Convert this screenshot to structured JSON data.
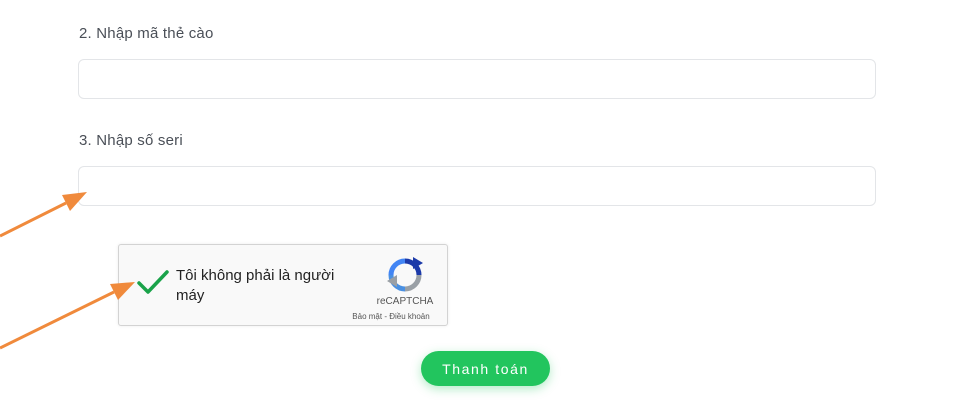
{
  "form": {
    "card_code_label": "2. Nhập mã thẻ cào",
    "card_code_value": "",
    "serial_label": "3. Nhập số seri",
    "serial_value": ""
  },
  "captcha": {
    "checked": true,
    "text": "Tôi không phải là người máy",
    "brand": "reCAPTCHA",
    "privacy_link": "Bảo mật",
    "separator": " - ",
    "terms_link": "Điều khoản"
  },
  "actions": {
    "pay_label": "Thanh toán"
  },
  "colors": {
    "pay_button": "#22c55e",
    "check_mark": "#1aa34a",
    "annotation_arrows": "#f08a3c"
  },
  "icons": {
    "check": "check-icon",
    "recaptcha": "recaptcha-logo-icon",
    "arrows": "annotation-arrow-icon"
  }
}
